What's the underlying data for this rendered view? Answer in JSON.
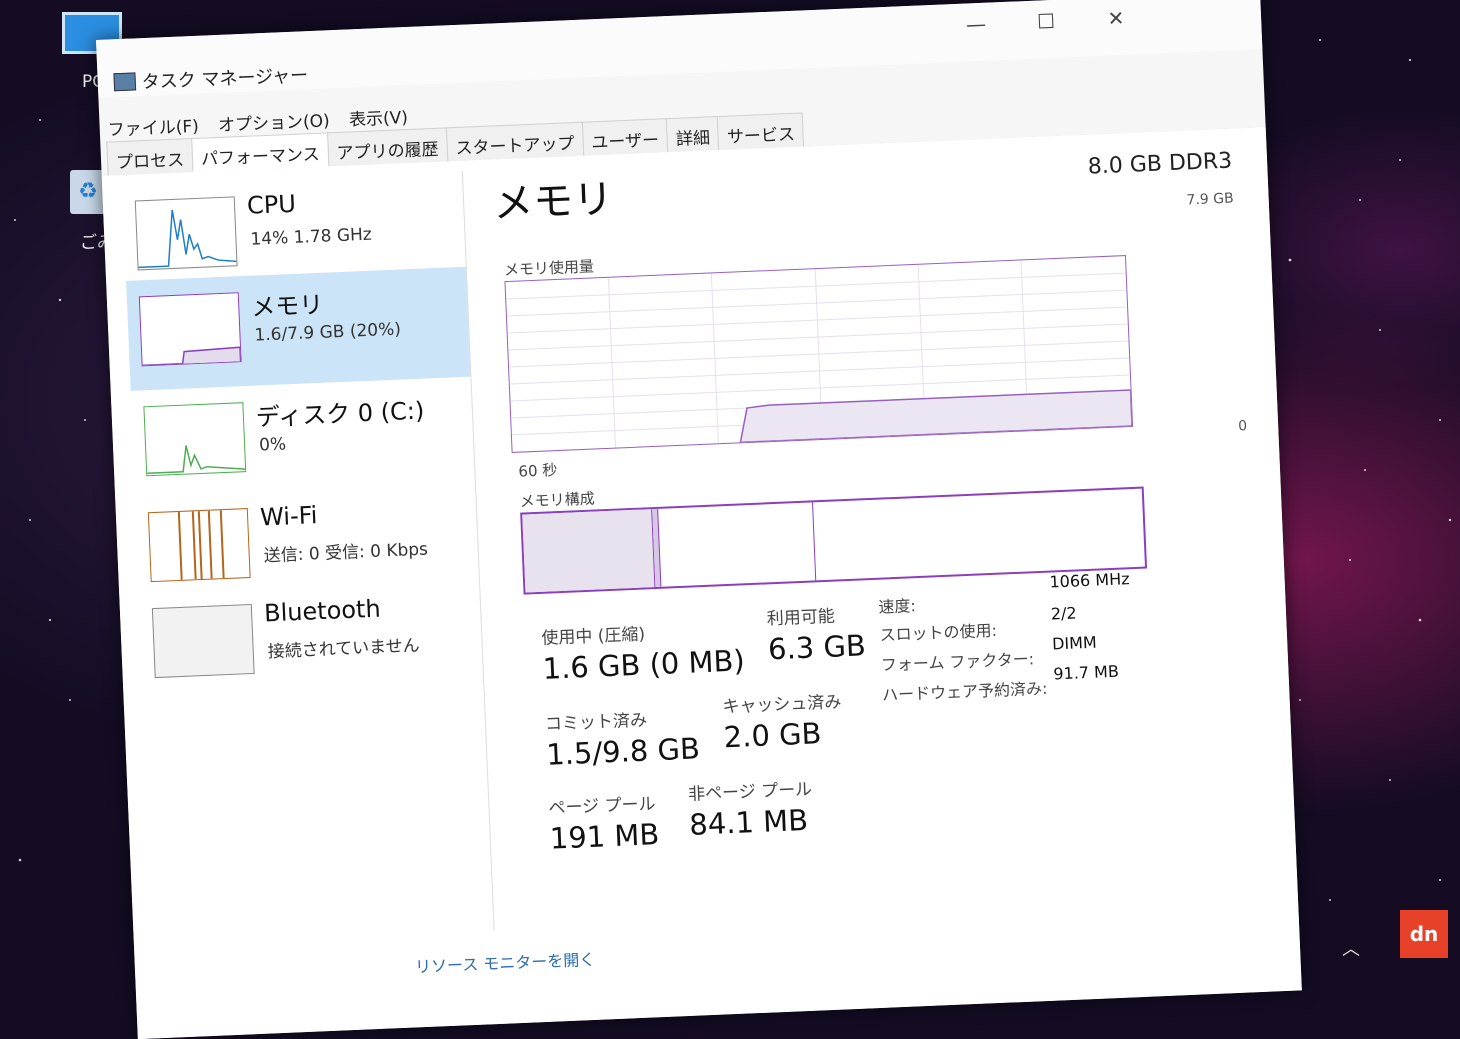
{
  "desktop": {
    "icon_pc_label": "PC",
    "icon_bin_label": "ごみ"
  },
  "window": {
    "title": "タスク マネージャー",
    "controls": {
      "minimize": "—",
      "maximize": "☐",
      "close": "✕"
    },
    "menu": [
      "ファイル(F)",
      "オプション(O)",
      "表示(V)"
    ],
    "tabs": [
      "プロセス",
      "パフォーマンス",
      "アプリの履歴",
      "スタートアップ",
      "ユーザー",
      "詳細",
      "サービス"
    ],
    "active_tab": "パフォーマンス"
  },
  "sidebar": {
    "items": [
      {
        "name": "CPU",
        "sub": "14%  1.78 GHz",
        "graph_color": "#1e7ec8"
      },
      {
        "name": "メモリ",
        "sub": "1.6/7.9 GB (20%)",
        "graph_color": "#8b3fbf"
      },
      {
        "name": "ディスク 0 (C:)",
        "sub": "0%",
        "graph_color": "#4caf50"
      },
      {
        "name": "Wi-Fi",
        "sub": "送信: 0  受信: 0 Kbps",
        "graph_color": "#b5651d"
      },
      {
        "name": "Bluetooth",
        "sub": "接続されていません",
        "graph_color": "#888888"
      }
    ],
    "selected_index": 1
  },
  "memory": {
    "title": "メモリ",
    "spec": "8.0 GB DDR3",
    "graph_max": "7.9 GB",
    "usage_label": "メモリ使用量",
    "zero_label": "0",
    "time_label": "60 秒",
    "composition_label": "メモリ構成",
    "accent_color": "#8a3fbf",
    "composition": {
      "in_use_fraction": 0.21,
      "modified_fraction": 0.01,
      "standby_fraction": 0.25
    },
    "stats": {
      "in_use_label": "使用中 (圧縮)",
      "in_use_value": "1.6 GB (0 MB)",
      "available_label": "利用可能",
      "available_value": "6.3 GB",
      "committed_label": "コミット済み",
      "committed_value": "1.5/9.8 GB",
      "cached_label": "キャッシュ済み",
      "cached_value": "2.0 GB",
      "paged_label": "ページ プール",
      "paged_value": "191 MB",
      "nonpaged_label": "非ページ プール",
      "nonpaged_value": "84.1 MB"
    },
    "details": [
      {
        "label": "速度:",
        "value": "1066 MHz"
      },
      {
        "label": "スロットの使用:",
        "value": "2/2"
      },
      {
        "label": "フォーム ファクター:",
        "value": "DIMM"
      },
      {
        "label": "ハードウェア予約済み:",
        "value": "91.7 MB"
      }
    ]
  },
  "footer": {
    "link": "リソース モニターを開く"
  },
  "watermark": "dn"
}
